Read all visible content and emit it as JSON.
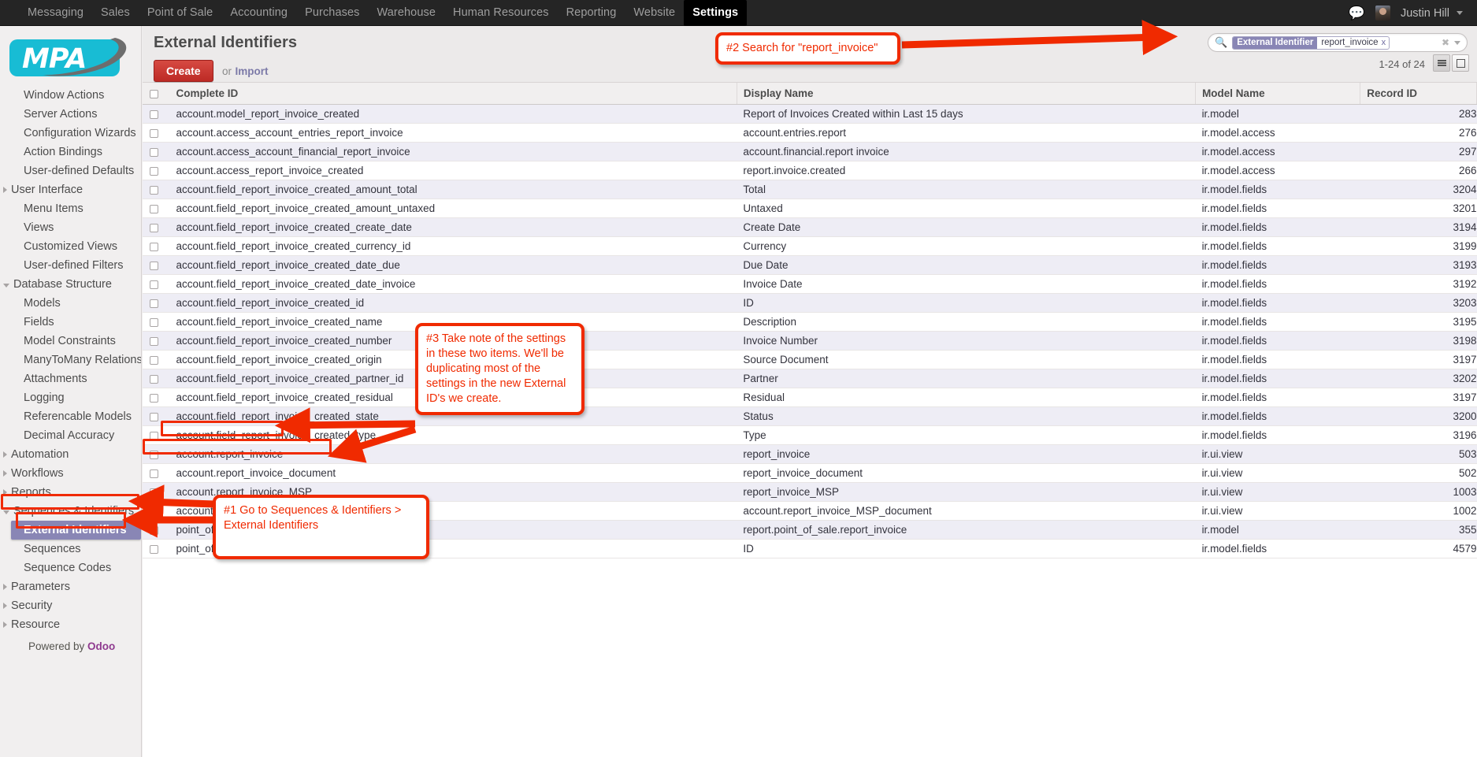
{
  "topbar": {
    "menu": [
      {
        "label": "Messaging",
        "active": false
      },
      {
        "label": "Sales",
        "active": false
      },
      {
        "label": "Point of Sale",
        "active": false
      },
      {
        "label": "Accounting",
        "active": false
      },
      {
        "label": "Purchases",
        "active": false
      },
      {
        "label": "Warehouse",
        "active": false
      },
      {
        "label": "Human Resources",
        "active": false
      },
      {
        "label": "Reporting",
        "active": false
      },
      {
        "label": "Website",
        "active": false
      },
      {
        "label": "Settings",
        "active": true
      }
    ],
    "chat_icon": "chat-bubble-icon",
    "user_name": "Justin Hill"
  },
  "sidebar": {
    "logo_text": "MPA",
    "groups": [
      {
        "type": "items",
        "items": [
          "Window Actions",
          "Server Actions",
          "Configuration Wizards",
          "Action Bindings",
          "User-defined Defaults"
        ]
      },
      {
        "type": "group",
        "label": "User Interface",
        "expanded": false,
        "items": [
          "Menu Items",
          "Views",
          "Customized Views",
          "User-defined Filters"
        ]
      },
      {
        "type": "group",
        "label": "Database Structure",
        "expanded": true,
        "items": [
          "Models",
          "Fields",
          "Model Constraints",
          "ManyToMany Relations",
          "Attachments",
          "Logging",
          "Referencable Models",
          "Decimal Accuracy"
        ]
      },
      {
        "type": "group",
        "label": "Automation",
        "expanded": false,
        "items": []
      },
      {
        "type": "group",
        "label": "Workflows",
        "expanded": false,
        "items": []
      },
      {
        "type": "group",
        "label": "Reports",
        "expanded": false,
        "items": []
      },
      {
        "type": "group",
        "label": "Sequences & Identifiers",
        "expanded": true,
        "items": [
          "External Identifiers",
          "Sequences",
          "Sequence Codes"
        ],
        "selected": "External Identifiers"
      },
      {
        "type": "group",
        "label": "Parameters",
        "expanded": false,
        "items": []
      },
      {
        "type": "group",
        "label": "Security",
        "expanded": false,
        "items": []
      },
      {
        "type": "group",
        "label": "Resource",
        "expanded": false,
        "items": []
      }
    ],
    "footer_prefix": "Powered by ",
    "footer_brand": "Odoo"
  },
  "main": {
    "page_title": "External Identifiers",
    "create_label": "Create",
    "or_label": "or",
    "import_label": "Import",
    "pager": "1-24 of 24",
    "search": {
      "facet_category": "External Identifier",
      "facet_value": "report_invoice",
      "facet_remove": "x",
      "clear_icon": "clear-circle-icon",
      "dropdown_icon": "chevron-down-icon"
    },
    "columns": [
      "Complete ID",
      "Display Name",
      "Model Name",
      "Record ID"
    ],
    "rows": [
      {
        "complete_id": "account.model_report_invoice_created",
        "display_name": "Report of Invoices Created within Last 15 days",
        "model_name": "ir.model",
        "record_id": "283"
      },
      {
        "complete_id": "account.access_account_entries_report_invoice",
        "display_name": "account.entries.report",
        "model_name": "ir.model.access",
        "record_id": "276"
      },
      {
        "complete_id": "account.access_account_financial_report_invoice",
        "display_name": "account.financial.report invoice",
        "model_name": "ir.model.access",
        "record_id": "297"
      },
      {
        "complete_id": "account.access_report_invoice_created",
        "display_name": "report.invoice.created",
        "model_name": "ir.model.access",
        "record_id": "266"
      },
      {
        "complete_id": "account.field_report_invoice_created_amount_total",
        "display_name": "Total",
        "model_name": "ir.model.fields",
        "record_id": "3204"
      },
      {
        "complete_id": "account.field_report_invoice_created_amount_untaxed",
        "display_name": "Untaxed",
        "model_name": "ir.model.fields",
        "record_id": "3201"
      },
      {
        "complete_id": "account.field_report_invoice_created_create_date",
        "display_name": "Create Date",
        "model_name": "ir.model.fields",
        "record_id": "3194"
      },
      {
        "complete_id": "account.field_report_invoice_created_currency_id",
        "display_name": "Currency",
        "model_name": "ir.model.fields",
        "record_id": "3199"
      },
      {
        "complete_id": "account.field_report_invoice_created_date_due",
        "display_name": "Due Date",
        "model_name": "ir.model.fields",
        "record_id": "3193"
      },
      {
        "complete_id": "account.field_report_invoice_created_date_invoice",
        "display_name": "Invoice Date",
        "model_name": "ir.model.fields",
        "record_id": "3192"
      },
      {
        "complete_id": "account.field_report_invoice_created_id",
        "display_name": "ID",
        "model_name": "ir.model.fields",
        "record_id": "3203"
      },
      {
        "complete_id": "account.field_report_invoice_created_name",
        "display_name": "Description",
        "model_name": "ir.model.fields",
        "record_id": "3195"
      },
      {
        "complete_id": "account.field_report_invoice_created_number",
        "display_name": "Invoice Number",
        "model_name": "ir.model.fields",
        "record_id": "3198"
      },
      {
        "complete_id": "account.field_report_invoice_created_origin",
        "display_name": "Source Document",
        "model_name": "ir.model.fields",
        "record_id": "3197"
      },
      {
        "complete_id": "account.field_report_invoice_created_partner_id",
        "display_name": "Partner",
        "model_name": "ir.model.fields",
        "record_id": "3202"
      },
      {
        "complete_id": "account.field_report_invoice_created_residual",
        "display_name": "Residual",
        "model_name": "ir.model.fields",
        "record_id": "3197"
      },
      {
        "complete_id": "account.field_report_invoice_created_state",
        "display_name": "Status",
        "model_name": "ir.model.fields",
        "record_id": "3200"
      },
      {
        "complete_id": "account.field_report_invoice_created_type",
        "display_name": "Type",
        "model_name": "ir.model.fields",
        "record_id": "3196"
      },
      {
        "complete_id": "account.report_invoice",
        "display_name": "report_invoice",
        "model_name": "ir.ui.view",
        "record_id": "503"
      },
      {
        "complete_id": "account.report_invoice_document",
        "display_name": "report_invoice_document",
        "model_name": "ir.ui.view",
        "record_id": "502"
      },
      {
        "complete_id": "account.report_invoice_MSP",
        "display_name": "report_invoice_MSP",
        "model_name": "ir.ui.view",
        "record_id": "1003"
      },
      {
        "complete_id": "account.report_invoice_MSP_document",
        "display_name": "account.report_invoice_MSP_document",
        "model_name": "ir.ui.view",
        "record_id": "1002"
      },
      {
        "complete_id": "point_of_sale.report_invoice",
        "display_name": "report.point_of_sale.report_invoice",
        "model_name": "ir.model",
        "record_id": "355"
      },
      {
        "complete_id": "point_of_sale.field_report_invoice_id",
        "display_name": "ID",
        "model_name": "ir.model.fields",
        "record_id": "4579"
      }
    ]
  },
  "annotations": [
    {
      "id": "note-1",
      "text": "#1 Go to Sequences & Identifiers > External Identifiers"
    },
    {
      "id": "note-2",
      "text": "#2 Search for \"report_invoice\""
    },
    {
      "id": "note-3",
      "text": "#3 Take note of the settings in these two items. We'll be duplicating most of the settings in the new External ID's we create."
    }
  ],
  "colors": {
    "accent_red": "#f02a00",
    "brand_cyan": "#18bcd4",
    "selection_purple": "#8986b5",
    "create_red": "#cf3530",
    "odoo_purple": "#8f3a8f"
  }
}
